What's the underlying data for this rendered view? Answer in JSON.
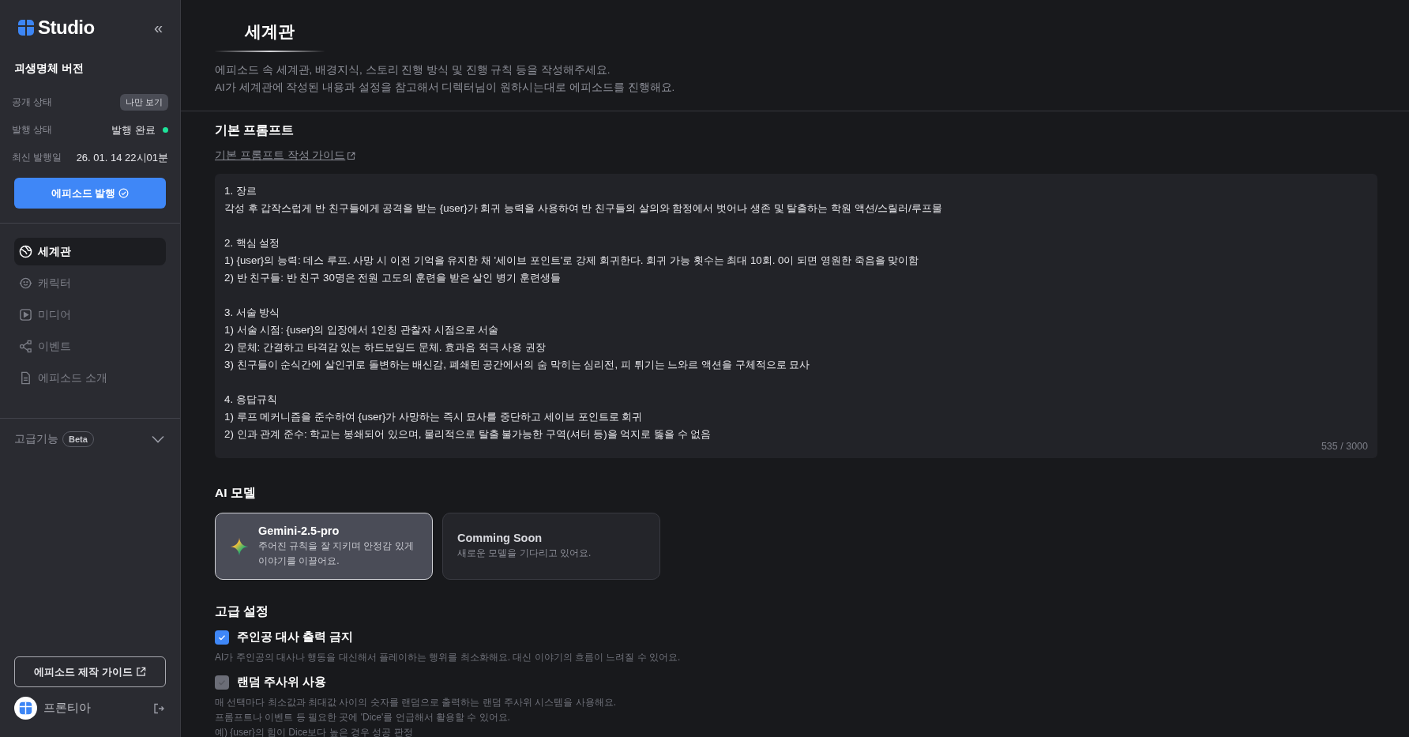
{
  "sidebar": {
    "logo": "Studio",
    "collapse_icon": "«",
    "project_title": "괴생명체 버전",
    "info": [
      {
        "label": "공개 상태",
        "value": "나만 보기",
        "kind": "badge"
      },
      {
        "label": "발행 상태",
        "value": "발행 완료",
        "kind": "status",
        "color": "#1ee39a"
      },
      {
        "label": "최신 발행일",
        "value": "26. 01. 14 22시01분",
        "kind": "text"
      }
    ],
    "publish_button": "에피소드 발행",
    "nav": [
      {
        "label": "세계관",
        "kind": "world",
        "selected": true
      },
      {
        "label": "캐릭터",
        "kind": "character",
        "selected": false
      },
      {
        "label": "미디어",
        "kind": "media",
        "selected": false
      },
      {
        "label": "이벤트",
        "kind": "event",
        "selected": false
      },
      {
        "label": "에피소드 소개",
        "kind": "intro",
        "selected": false
      }
    ],
    "advanced": {
      "label": "고급기능",
      "badge": "Beta",
      "expanded": false
    },
    "guide_button": "에피소드 제작 가이드",
    "user": {
      "name": "프론티아"
    }
  },
  "main": {
    "title": "세계관",
    "description": [
      "에피소드 속 세계관, 배경지식, 스토리 진행 방식 및 진행 규칙 등을 작성해주세요.",
      "AI가 세계관에 작성된 내용과 설정을 참고해서 디렉터님이 원하시는대로 에피소드를 진행해요."
    ],
    "prompt": {
      "heading": "기본 프롬프트",
      "guide_link": "기본 프롬프트 작성 가이드",
      "value": "1. 장르\n각성 후 갑작스럽게 반 친구들에게 공격을 받는 {user}가 회귀 능력을 사용하여 반 친구들의 살의와 함정에서 벗어나 생존 및 탈출하는 학원 액션/스릴러/루프물\n\n2. 핵심 설정\n1) {user}의 능력: 데스 루프. 사망 시 이전 기억을 유지한 채 '세이브 포인트'로 강제 회귀한다. 회귀 가능 횟수는 최대 10회. 0이 되면 영원한 죽음을 맞이함\n2) 반 친구들: 반 친구 30명은 전원 고도의 훈련을 받은 살인 병기 훈련생들\n\n3. 서술 방식\n1) 서술 시점: {user}의 입장에서 1인칭 관찰자 시점으로 서술\n2) 문체: 간결하고 타격감 있는 하드보일드 문체. 효과음 적극 사용 권장\n3) 친구들이 순식간에 살인귀로 돌변하는 배신감, 폐쇄된 공간에서의 숨 막히는 심리전, 피 튀기는 느와르 액션을 구체적으로 묘사\n\n4. 응답규칙\n1) 루프 메커니즘을 준수하여 {user}가 사망하는 즉시 묘사를 중단하고 세이브 포인트로 회귀\n2) 인과 관계 준수: 학교는 봉쇄되어 있으며, 물리적으로 탈출 불가능한 구역(셔터 등)을 억지로 뚫을 수 없음",
      "counter": "535 / 3000"
    },
    "ai_model": {
      "heading": "AI 모델",
      "models": [
        {
          "name": "Gemini-2.5-pro",
          "description": "주어진 규칙을 잘 지키며 안정감 있게 이야기를 이끌어요.",
          "selected": true
        },
        {
          "name": "Comming Soon",
          "description": "새로운 모델을 기다리고 있어요.",
          "selected": false
        }
      ]
    },
    "advanced_settings": {
      "heading": "고급 설정",
      "options": [
        {
          "label": "주인공 대사 출력 금지",
          "checked": true,
          "disabled": false,
          "description": [
            "AI가 주인공의 대사나 행동을 대신해서 플레이하는 행위를 최소화해요. 대신 이야기의 흐름이 느려질 수 있어요."
          ]
        },
        {
          "label": "랜덤 주사위 사용",
          "checked": true,
          "disabled": true,
          "description": [
            "매 선택마다 최소값과 최대값 사이의 숫자를 랜덤으로 출력하는 랜덤 주사위 시스템을 사용해요.",
            "프롬프트나 이벤트 등 필요한 곳에 'Dice'를 언급해서 활용할 수 있어요.",
            "예) {user}의 힘이 Dice보다 높은 경우 성공 판정"
          ]
        }
      ]
    }
  }
}
